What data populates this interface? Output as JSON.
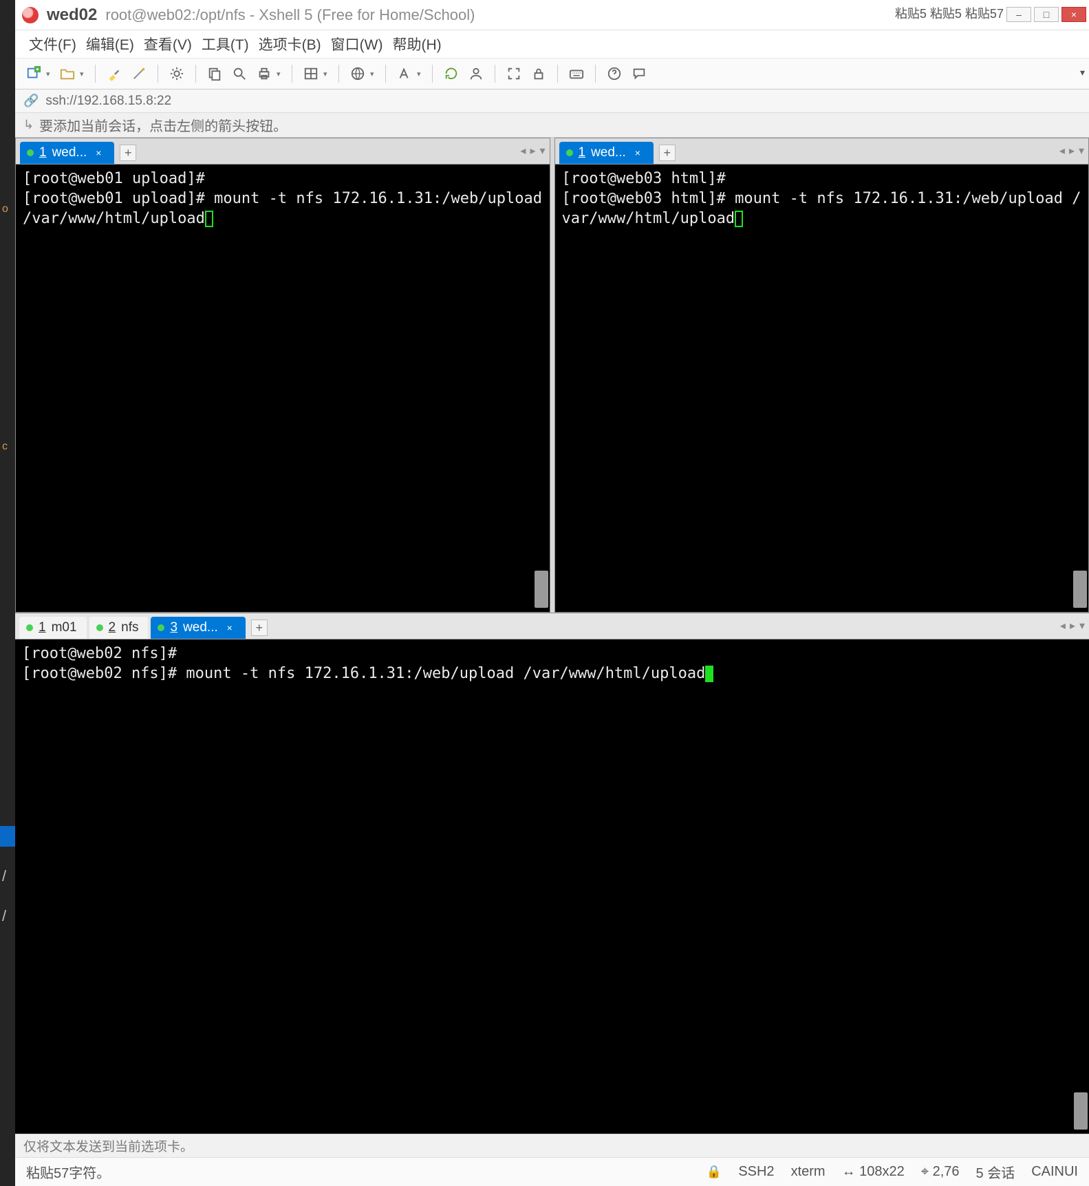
{
  "title": {
    "primary": "wed02",
    "secondary": "root@web02:/opt/nfs - Xshell 5 (Free for Home/School)",
    "pins": "粘贴5 粘贴5 粘贴57"
  },
  "win_buttons": {
    "min": "–",
    "max": "□",
    "close": "×"
  },
  "menu": [
    "文件(F)",
    "编辑(E)",
    "查看(V)",
    "工具(T)",
    "选项卡(B)",
    "窗口(W)",
    "帮助(H)"
  ],
  "address": {
    "url": "ssh://192.168.15.8:22"
  },
  "hint": "要添加当前会话，点击左侧的箭头按钮。",
  "top_panes": [
    {
      "tab": {
        "num": "1",
        "label": "wed..."
      },
      "lines": [
        "[root@web01 upload]#",
        "[root@web01 upload]# mount -t nfs 172.16.1.31:/web/upload /var/www/html/upload"
      ]
    },
    {
      "tab": {
        "num": "1",
        "label": "wed..."
      },
      "lines": [
        "[root@web03 html]#",
        "[root@web03 html]# mount -t nfs 172.16.1.31:/web/upload /var/www/html/upload"
      ]
    }
  ],
  "bottom": {
    "tabs": [
      {
        "num": "1",
        "label": "m01",
        "active": false
      },
      {
        "num": "2",
        "label": "nfs",
        "active": false
      },
      {
        "num": "3",
        "label": "wed...",
        "active": true
      }
    ],
    "lines": [
      "[root@web02 nfs]#",
      "[root@web02 nfs]# mount -t nfs 172.16.1.31:/web/upload /var/www/html/upload"
    ]
  },
  "send_bar": "仅将文本发送到当前选项卡。",
  "status": {
    "left": "粘贴57字符。",
    "ssh": "SSH2",
    "xterm": "xterm",
    "size": "108x22",
    "pos": "2,76",
    "sessions": "5 会话",
    "caps": "CAINUI"
  },
  "icons": {
    "new": "new-session-icon",
    "open": "open-icon",
    "highlight": "highlight-icon",
    "wand": "wand-icon",
    "gear": "gear-icon",
    "copy": "copy-icon",
    "search": "search-icon",
    "print": "print-icon",
    "layout": "layout-icon",
    "globe": "globe-icon",
    "font": "font-icon",
    "refresh": "refresh-icon",
    "user": "user-icon",
    "fullscreen": "fullscreen-icon",
    "lock": "lock-icon",
    "keyboard": "keyboard-icon",
    "help": "help-icon",
    "chat": "chat-icon"
  }
}
